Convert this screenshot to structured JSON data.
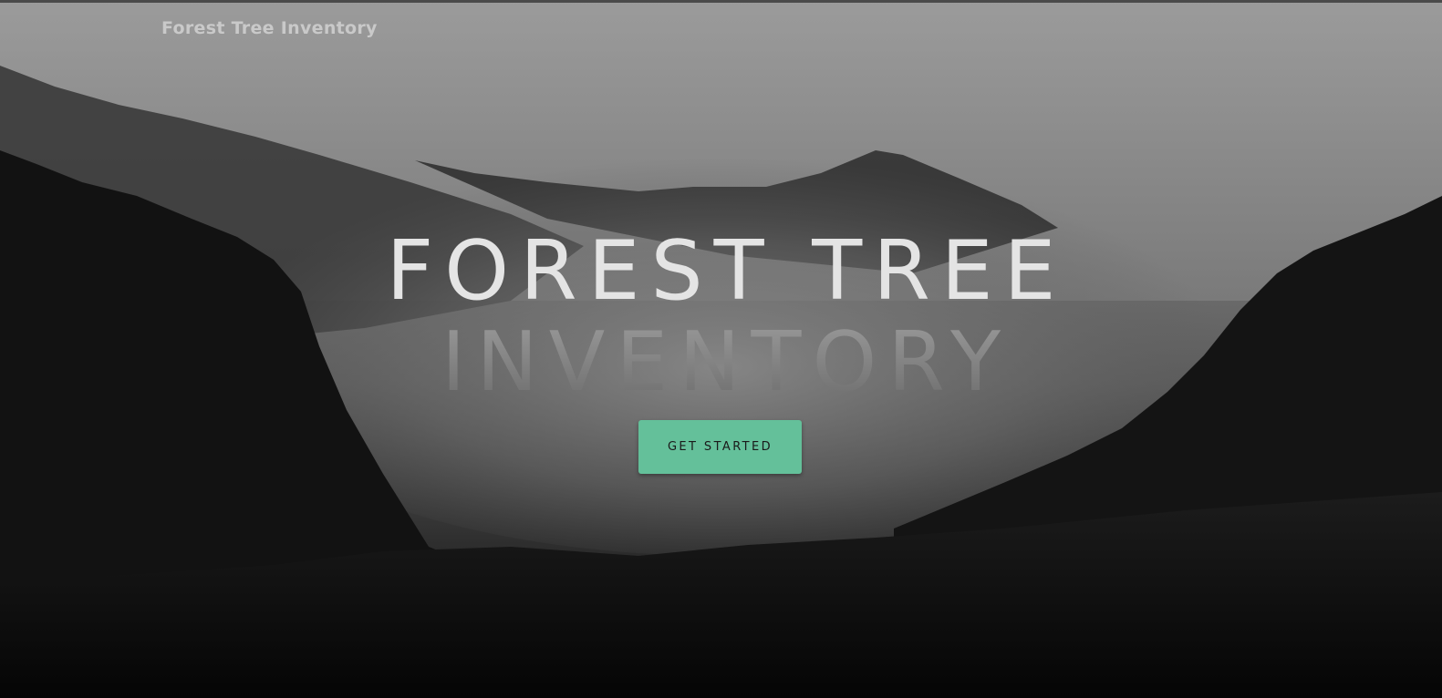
{
  "navbar": {
    "brand": "Forest Tree Inventory"
  },
  "hero": {
    "headline_line1": "FOREST TREE",
    "headline_line2": "INVENTORY",
    "cta_label": "GET STARTED",
    "background": "misty-forest-mountains-image"
  },
  "colors": {
    "accent": "#64c09a",
    "brand_text": "#c9c9c9",
    "headline": "#e4e4e4"
  }
}
